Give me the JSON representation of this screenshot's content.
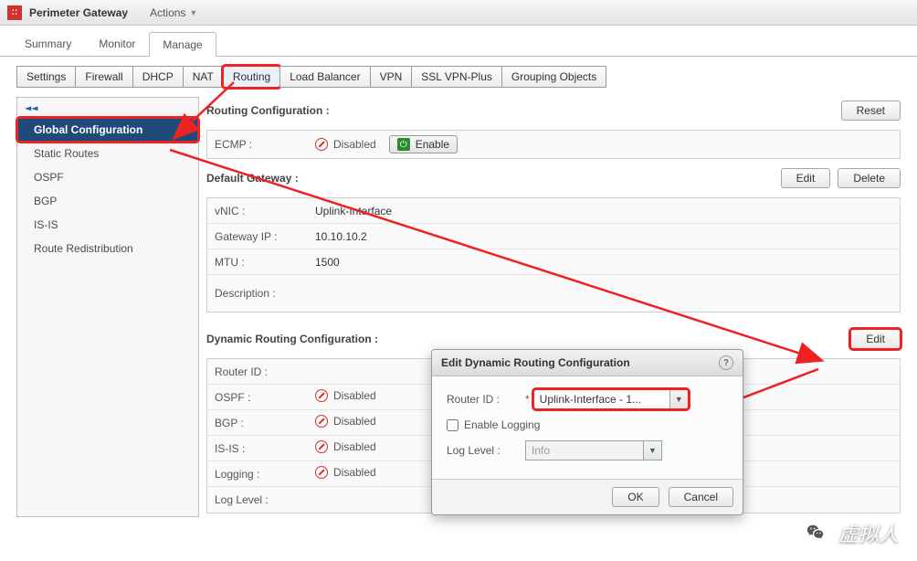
{
  "appTitle": "Perimeter Gateway",
  "actionsLabel": "Actions",
  "tabsPrimary": {
    "summary": "Summary",
    "monitor": "Monitor",
    "manage": "Manage"
  },
  "subtabs": {
    "settings": "Settings",
    "firewall": "Firewall",
    "dhcp": "DHCP",
    "nat": "NAT",
    "routing": "Routing",
    "loadBalancer": "Load Balancer",
    "vpn": "VPN",
    "sslvpn": "SSL VPN-Plus",
    "grouping": "Grouping Objects"
  },
  "sidebar": {
    "items": {
      "globalconf": "Global Configuration",
      "staticroutes": "Static Routes",
      "ospf": "OSPF",
      "bgp": "BGP",
      "isis": "IS-IS",
      "redist": "Route Redistribution"
    }
  },
  "routing": {
    "title": "Routing Configuration :",
    "resetBtn": "Reset",
    "ecmpLabel": "ECMP :",
    "disabledText": "Disabled",
    "enableBtn": "Enable"
  },
  "defaultGw": {
    "title": "Default Gateway :",
    "editBtn": "Edit",
    "deleteBtn": "Delete",
    "vnicLbl": "vNIC :",
    "vnicVal": "Uplink-Interface",
    "gwipLbl": "Gateway IP :",
    "gwipVal": "10.10.10.2",
    "mtuLbl": "MTU :",
    "mtuVal": "1500",
    "descLbl": "Description :",
    "descVal": ""
  },
  "dynroute": {
    "title": "Dynamic Routing Configuration :",
    "editBtn": "Edit",
    "rows": {
      "routerIdLbl": "Router ID :",
      "routerIdVal": "",
      "ospfLbl": "OSPF :",
      "bgpLbl": "BGP :",
      "isisLbl": "IS-IS :",
      "loggingLbl": "Logging :",
      "loglevelLbl": "Log Level :"
    },
    "disabledText": "Disabled"
  },
  "dialog": {
    "title": "Edit Dynamic Routing Configuration",
    "routerIdLbl": "Router ID :",
    "routerIdVal": "Uplink-Interface - 1...",
    "enableLogging": "Enable Logging",
    "logLevelLbl": "Log Level :",
    "logLevelVal": "Info",
    "ok": "OK",
    "cancel": "Cancel"
  },
  "watermark": "虚拟人"
}
